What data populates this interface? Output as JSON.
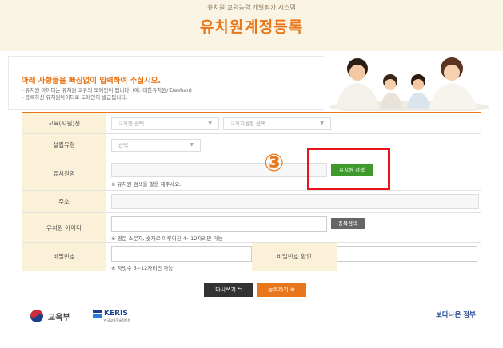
{
  "header": {
    "subtitle": "유치원 교원능력 개발평가 시스템",
    "title": "유치원계정등록"
  },
  "notice": {
    "title": "아래 사항들을 빠짐없이 입력하여 주십시오.",
    "lines": [
      "- 유치원 아이디는 유치원 고유의 도메인이 됩니다. (예: 대한유치원/'Daehan)",
      "- 등록하신 유치원아이디로 도메인이 발급됩니다."
    ]
  },
  "form": {
    "education_office": {
      "label": "교육(지원)청",
      "office_select": "교육청 선택",
      "support_select": "교육지원청 선택"
    },
    "establishment": {
      "label": "설립유형",
      "select": "선택"
    },
    "kindergarten_name": {
      "label": "유치원명",
      "search_button": "유치원 검색",
      "hint": "※ 유치원 검색을 활용 해주세요."
    },
    "address": {
      "label": "주소"
    },
    "kindergarten_id": {
      "label": "유치원 아이디",
      "check_button": "중복검색",
      "hint": "※ 영문 소문자, 숫자로 이루어진 4~12자리만 가능"
    },
    "password": {
      "label": "비밀번호",
      "hint": "※ 자릿수 6~12자리만 가능",
      "confirm_label": "비밀번호 확인"
    }
  },
  "actions": {
    "reset_label": "다시쓰기 ⮌",
    "submit_label": "등록하기 ⊕"
  },
  "annotation": {
    "step_number": "③"
  },
  "footer": {
    "moe_text": "교육부",
    "keris_text": "KERIS",
    "keris_sub": "한국교육학술정보원",
    "gov_text": "보다나은 정부"
  },
  "colors": {
    "accent": "#e8761a",
    "label_bg": "#fbf1d8",
    "green": "#3e9a2a",
    "highlight_red": "#e8141c"
  }
}
